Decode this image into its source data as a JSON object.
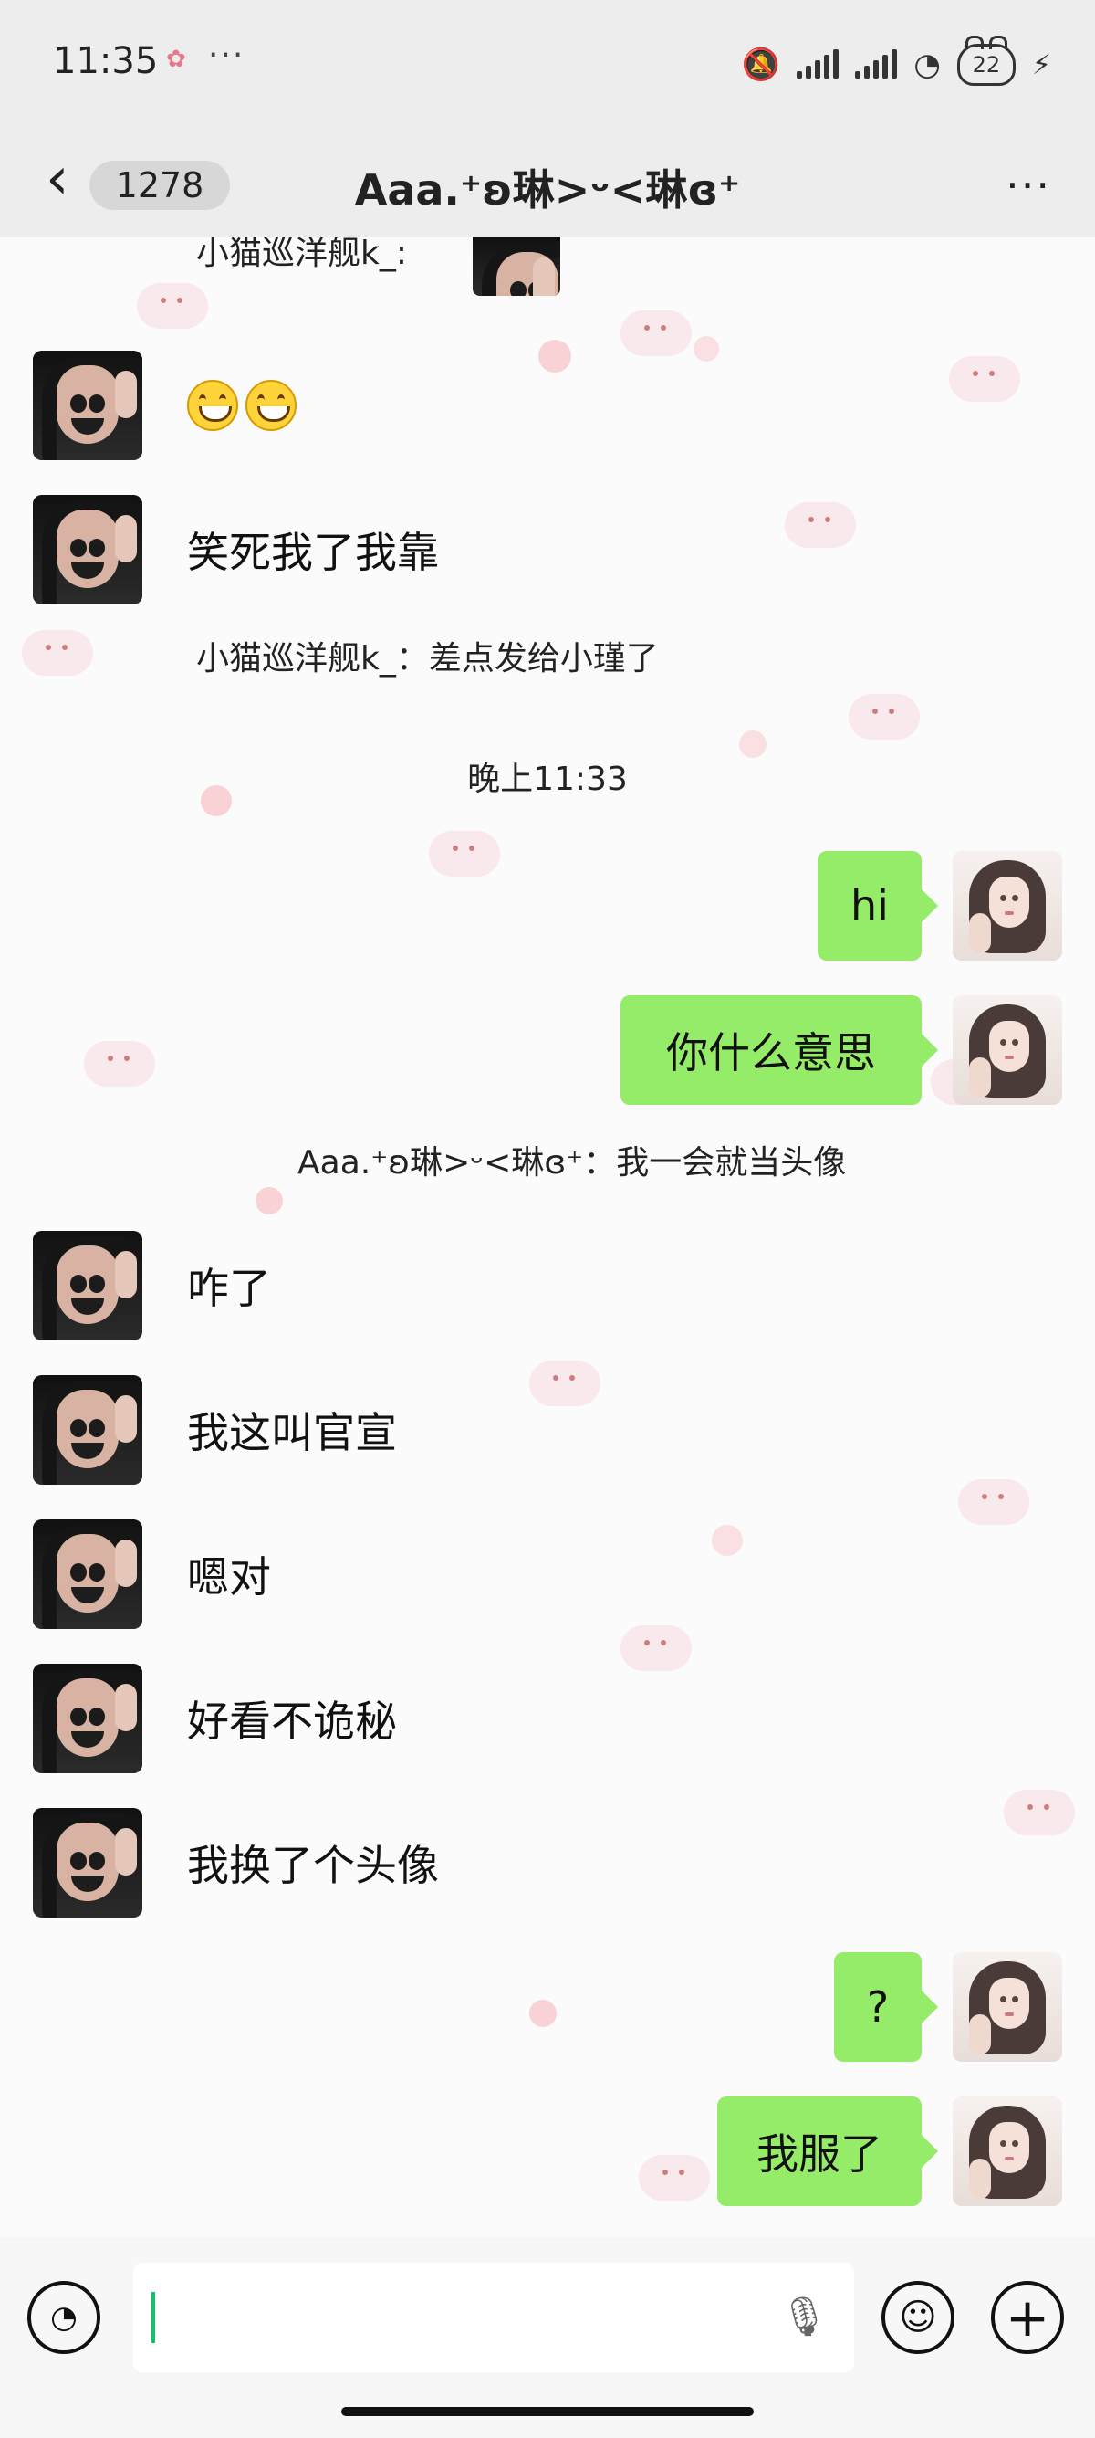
{
  "status_bar": {
    "time": "11:35",
    "extra": "···",
    "battery": "22",
    "icons": [
      "muted-bell-icon",
      "signal-icon",
      "signal-icon",
      "wifi-icon",
      "battery-icon",
      "charging-icon"
    ]
  },
  "nav": {
    "back_icon": "chevron-left-icon",
    "unread_count": "1278",
    "title": "Aaa.⁺ʚ琳>ᵕ<琳ɞ⁺",
    "more": "···"
  },
  "chat": {
    "top_partial": "小猫巡洋舰k_:",
    "messages_left": [
      {
        "type": "emoji",
        "emoji_names": [
          "grinning-face-icon",
          "grinning-face-icon"
        ]
      },
      {
        "type": "text",
        "text": "笑死我了我靠"
      },
      {
        "type": "text",
        "text": "咋了"
      },
      {
        "type": "text",
        "text": "我这叫官宣"
      },
      {
        "type": "text",
        "text": "嗯对"
      },
      {
        "type": "text",
        "text": "好看不诡秘"
      },
      {
        "type": "text",
        "text": "我换了个头像"
      }
    ],
    "system_lines": [
      "小猫巡洋舰k_：差点发给小瑾了",
      "晚上11:33",
      "Aaa.⁺ʚ琳>ᵕ<琳ɞ⁺：我一会就当头像"
    ],
    "messages_right": [
      {
        "text": "hi"
      },
      {
        "text": "你什么意思"
      },
      {
        "text": "?"
      },
      {
        "text": "我服了"
      }
    ]
  },
  "input": {
    "voice_icon": "voice-icon",
    "mic_icon": "microphone-icon",
    "emoji_icon": "emoji-icon",
    "plus_icon": "plus-icon"
  },
  "colors": {
    "status_bg": "#ededed",
    "bubble_green": "#95ec69",
    "cursor_green": "#12c26b"
  }
}
